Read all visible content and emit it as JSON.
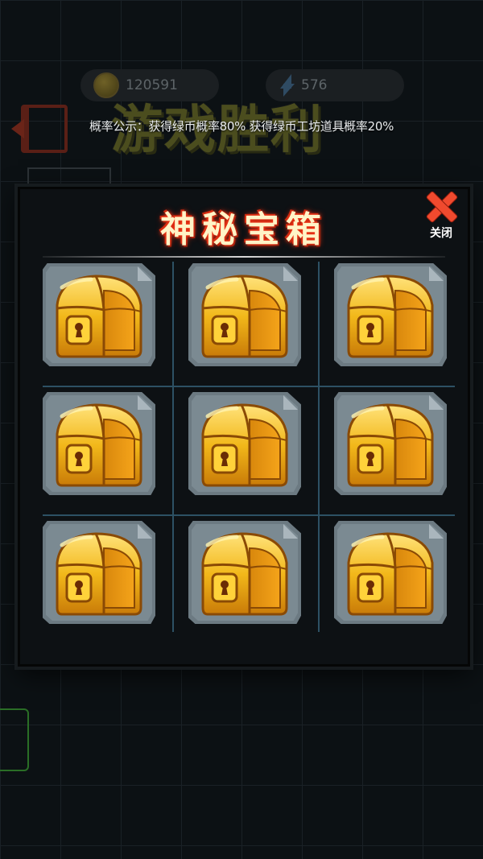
{
  "hud": {
    "coins": "120591",
    "energy": "576",
    "coin_icon": "coin-icon",
    "energy_icon": "lightning-icon"
  },
  "victory_title": "游戏胜利",
  "probability_text": "概率公示：获得绿币概率80% 获得绿币工坊道具概率20%",
  "modal": {
    "title": "神秘宝箱",
    "close_label": "关闭",
    "close_icon": "close-x-icon",
    "chests": [
      {
        "icon": "treasure-chest-icon"
      },
      {
        "icon": "treasure-chest-icon"
      },
      {
        "icon": "treasure-chest-icon"
      },
      {
        "icon": "treasure-chest-icon"
      },
      {
        "icon": "treasure-chest-icon"
      },
      {
        "icon": "treasure-chest-icon"
      },
      {
        "icon": "treasure-chest-icon"
      },
      {
        "icon": "treasure-chest-icon"
      },
      {
        "icon": "treasure-chest-icon"
      }
    ]
  },
  "colors": {
    "title_glow": "#ff3a1a",
    "close": "#f04a2e",
    "chest_gold": "#f2b81a",
    "slot": "#7b8a92"
  }
}
